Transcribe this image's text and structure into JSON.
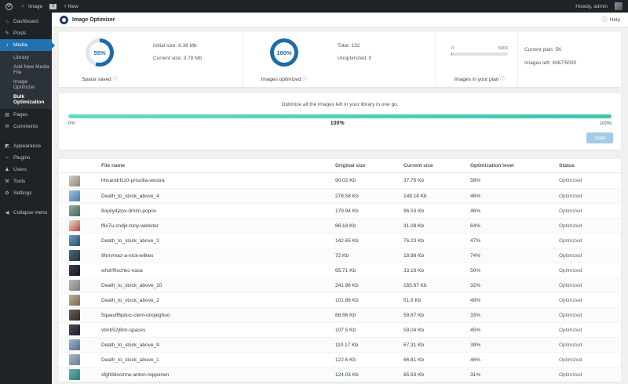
{
  "colors": {
    "admin-dark": "#1d2327",
    "active-blue": "#2271b1",
    "accent-blue": "#1b6ca8",
    "progress-teal": "#46c9b9",
    "button-blue": "#a5cbe5"
  },
  "admin_bar": {
    "site_name": "Image",
    "comment_count": "0",
    "new_label": "+ New",
    "howdy_text": "Howdy, admin"
  },
  "sidebar": {
    "items": [
      {
        "label": "Dashboard",
        "icon": "dashboard-icon"
      },
      {
        "label": "Posts",
        "icon": "posts-icon"
      },
      {
        "label": "Media",
        "icon": "media-icon",
        "active": true,
        "submenu": [
          "Library",
          "Add New Media File",
          "Image Optimizer",
          "Bulk Optimization"
        ],
        "submenu_active": "Bulk Optimization"
      },
      {
        "label": "Pages",
        "icon": "pages-icon"
      },
      {
        "label": "Comments",
        "icon": "comments-icon"
      },
      {
        "label": "Appearance",
        "icon": "appearance-icon",
        "gap": true
      },
      {
        "label": "Plugins",
        "icon": "plugins-icon"
      },
      {
        "label": "Users",
        "icon": "users-icon"
      },
      {
        "label": "Tools",
        "icon": "tools-icon"
      },
      {
        "label": "Settings",
        "icon": "settings-icon"
      }
    ],
    "collapse_label": "Collapse menu"
  },
  "page_header": {
    "title": "Image Optimizer",
    "help_label": "Help"
  },
  "stats": {
    "space_saved": {
      "percent_label": "55%",
      "percent_value": 55,
      "line1": "Initial size: 8.38 Mb",
      "line2": "Current size: 3.78 Mb",
      "label": "Space saved"
    },
    "images_optimized": {
      "percent_label": "100%",
      "percent_value": 100,
      "line1": "Total: 132",
      "line2": "Unoptimized: 0",
      "label": "Images optimized"
    },
    "plan_usage": {
      "min_label": "0",
      "max_label": "5000",
      "fill_percent": 1,
      "label": "Images in your plan"
    },
    "plan_info": {
      "line1": "Current plan: 5K",
      "line2": "Images left: 4967/5000"
    }
  },
  "bulk": {
    "description": "Optimize all the images left in your library in one go.",
    "progress_percent": 100,
    "left_label": "0%",
    "center_label": "100%",
    "right_label": "100%",
    "start_label": "Start"
  },
  "table": {
    "columns": [
      "File name",
      "Original size",
      "Current size",
      "Optimization level",
      "Status"
    ],
    "rows": [
      {
        "name": "hhcandrfzz0-priscilla-westra",
        "original": "90.02 Kb",
        "current": "37.76 Kb",
        "level": "58%",
        "status": "Optimized",
        "thumb": [
          "#d3ccc1",
          "#8d867b"
        ]
      },
      {
        "name": "Death_to_stock_above_4",
        "original": "278.58 Kb",
        "current": "149.14 Kb",
        "level": "46%",
        "status": "Optimized",
        "thumb": [
          "#9fc3dd",
          "#4a7ba6"
        ]
      },
      {
        "name": "8opiiy4jzpx-dmitri-popov",
        "original": "179.94 Kb",
        "current": "96.53 Kb",
        "level": "46%",
        "status": "Optimized",
        "thumb": [
          "#8fae9d",
          "#46675a"
        ]
      },
      {
        "name": "f9o7u-cndjk-tony-webster",
        "original": "86.18 Kb",
        "current": "31.08 Kb",
        "level": "64%",
        "status": "Optimized",
        "thumb": [
          "#e8ded2",
          "#b5473a"
        ]
      },
      {
        "name": "Death_to_stock_above_3",
        "original": "142.65 Kb",
        "current": "76.23 Kb",
        "level": "47%",
        "status": "Optimized",
        "thumb": [
          "#6f9cc0",
          "#2b4d6e"
        ]
      },
      {
        "name": "8hrrvmaz-a-nick-wilkes",
        "original": "72 Kb",
        "current": "18.98 Kb",
        "level": "74%",
        "status": "Optimized",
        "thumb": [
          "#4f6b74",
          "#22333a"
        ]
      },
      {
        "name": "whdrf9uchkc-nasa",
        "original": "65.71 Kb",
        "current": "33.16 Kb",
        "level": "50%",
        "status": "Optimized",
        "thumb": [
          "#3a3f55",
          "#14141f"
        ]
      },
      {
        "name": "Death_to_stock_above_10",
        "original": "241.96 Kb",
        "current": "165.67 Kb",
        "level": "32%",
        "status": "Optimized",
        "thumb": [
          "#b9b9b9",
          "#7d7d7d"
        ]
      },
      {
        "name": "Death_to_stock_above_2",
        "original": "101.86 Kb",
        "current": "51.8 Kb",
        "level": "49%",
        "status": "Optimized",
        "thumb": [
          "#c2b295",
          "#77684e"
        ]
      },
      {
        "name": "5qaeulf6pduc-clem-onojeghuo",
        "original": "88.56 Kb",
        "current": "59.67 Kb",
        "level": "33%",
        "status": "Optimized",
        "thumb": [
          "#6b6257",
          "#2e2a24"
        ]
      },
      {
        "name": "vbnb52j6trk-spaces",
        "original": "107.5 Kb",
        "current": "59.04 Kb",
        "level": "45%",
        "status": "Optimized",
        "thumb": [
          "#4a4a5e",
          "#1d1d28"
        ]
      },
      {
        "name": "Death_to_stock_above_9",
        "original": "110.17 Kb",
        "current": "67.31 Kb",
        "level": "39%",
        "status": "Optimized",
        "thumb": [
          "#9fb4c4",
          "#56718a"
        ]
      },
      {
        "name": "Death_to_stock_above_1",
        "original": "122.6 Kb",
        "current": "66.81 Kb",
        "level": "46%",
        "status": "Optimized",
        "thumb": [
          "#aab6c8",
          "#6e7f95"
        ]
      },
      {
        "name": "sfgh9dxcmrw-anton-repponen",
        "original": "124.03 Kb",
        "current": "65.63 Kb",
        "level": "31%",
        "status": "Optimized",
        "thumb": [
          "#63b0a8",
          "#2e7f78"
        ]
      }
    ]
  }
}
